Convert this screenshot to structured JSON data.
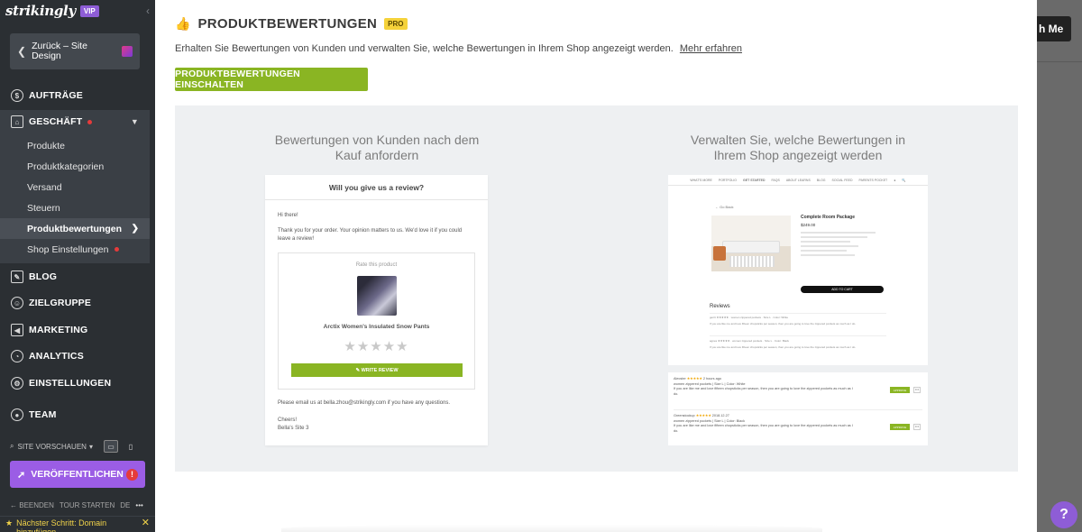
{
  "sidebar": {
    "logo": "strikingly",
    "vip": "VIP",
    "collapse": "‹",
    "back": "Zurück – Site Design",
    "nav": {
      "auftraege": "AUFTRÄGE",
      "geschaeft": "GESCHÄFT",
      "blog": "BLOG",
      "zielgruppe": "ZIELGRUPPE",
      "marketing": "MARKETING",
      "analytics": "ANALYTICS",
      "einstellungen": "EINSTELLUNGEN",
      "team": "TEAM"
    },
    "sub": {
      "produkte": "Produkte",
      "produktkategorien": "Produktkategorien",
      "versand": "Versand",
      "steuern": "Steuern",
      "produktbewertungen": "Produktbewertungen",
      "shop_einstellungen": "Shop Einstellungen"
    },
    "site_preview": "SITE VORSCHAUEN",
    "publish": "VERÖFFENTLICHEN",
    "footer": {
      "beenden": "BEENDEN",
      "tour": "TOUR STARTEN",
      "lang": "DE",
      "more": "•••"
    },
    "next_step": "Nächster Schritt: Domain hinzufügen"
  },
  "background": {
    "button_fragment": "h Me",
    "help": "?"
  },
  "panel": {
    "title": "PRODUKTBEWERTUNGEN",
    "badge": "PRO",
    "description": "Erhalten Sie Bewertungen von Kunden und verwalten Sie, welche Bewertungen in Ihrem Shop angezeigt werden.",
    "learn_more": "Mehr erfahren",
    "enable_button": "PRODUKTBEWERTUNGEN EINSCHALTEN",
    "left_title": "Bewertungen von Kunden nach dem Kauf anfordern",
    "right_title": "Verwalten Sie, welche Bewertungen in Ihrem Shop angezeigt werden"
  },
  "email": {
    "header": "Will you give us a review?",
    "greeting": "Hi there!",
    "body": "Thank you for your order. Your opinion matters to us. We'd love it if you could leave a review!",
    "rate_label": "Rate this product",
    "product_name": "Arctix Women's Insulated Snow Pants",
    "stars": "★★★★★",
    "write_review": "✎ WRITE REVIEW",
    "contact": "Please email us at bella.zhou@strikingly.com if you have any questions.",
    "closing": "Cheers!",
    "signature": "Bella's Site 3"
  },
  "shop": {
    "nav": [
      "WHAT'S MORE",
      "PORTFOLIO",
      "GET STARTED",
      "FAQS",
      "ABOUT LEARNS",
      "BLOG",
      "SOCIAL FEED",
      "PARENTS POCKET",
      "● ",
      "🔍"
    ],
    "back": "← Go Back",
    "package_title": "Complete Room Package",
    "package_price": "$249.00",
    "add_to_cart": "ADD TO CART",
    "reviews": "Reviews",
    "review_1_meta": "gerrit ★★★★★  ·  women zippered pockets  ·  Size L  ·  Color: White",
    "review_1_text": "If you are like me and love fifteen chopsticks per season, then you are going to love the zippered pockets as much as I do.",
    "review_2_meta": "agnes ★★★★★  ·  women zippered pockets  ·  Size L  ·  Color: Black",
    "review_2_text": "If you are like me and love fifteen chopsticks per season, then you are going to love the zippered pockets as much as I do."
  },
  "manage": {
    "rows": [
      {
        "author": "Alecster",
        "stars": "★★★★★",
        "date": "2 hours ago",
        "meta": "women zippered pockets  |  Size L  |  Color: White",
        "text": "If you are like me and love fifteen chopsticks per season, then you are going to love the zippered pockets as much as I do.",
        "action": "APPROVE",
        "more": "•••"
      },
      {
        "author": "Greenstockup",
        "stars": "★★★★★",
        "date": "2018.12.27",
        "meta": "women zippered pockets  |  Size L  |  Color: Black",
        "text": "If you are like me and love fifteen chopsticks per season, then you are going to love the zippered pockets as much as I do.",
        "action": "APPROVE",
        "more": "•••"
      }
    ]
  }
}
